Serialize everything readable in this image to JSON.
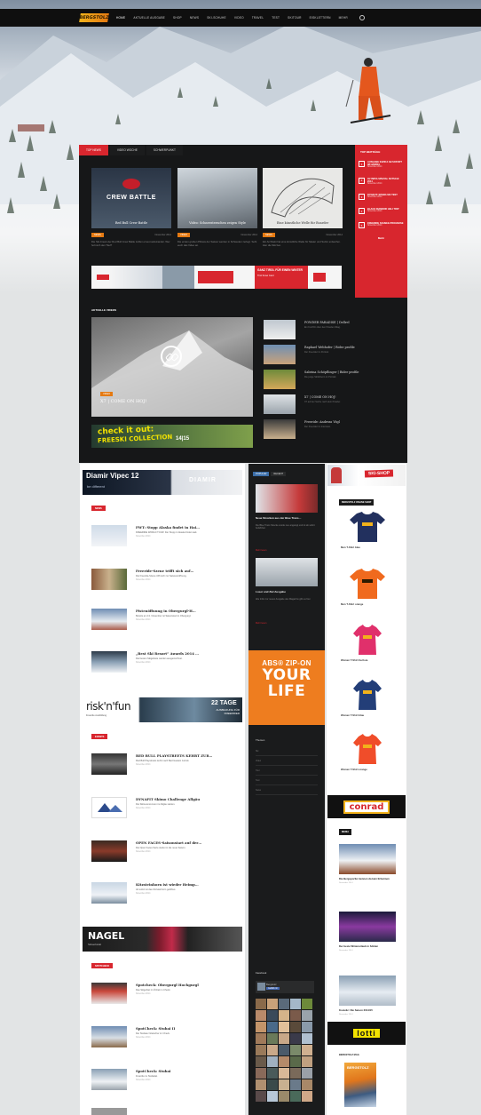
{
  "brand": {
    "logo_text": "BERGSTOLZ",
    "accent": "#d8262e",
    "orange": "#e57a12"
  },
  "nav": {
    "items": [
      "Home",
      "Aktuelle Ausgabe",
      "Shop",
      "News",
      "Ski-Schuhe",
      "Video",
      "Travel",
      "Test",
      "Skitour",
      "Eisklettern",
      "Mehr"
    ],
    "search_icon": "search-icon"
  },
  "feature_tabs": [
    "Top News",
    "Video Woche",
    "Schwerpunkt"
  ],
  "feature_cards": [
    {
      "caption": "Red Bull Crew Battle",
      "badge": "News",
      "date": "November 2014",
      "excerpt": "Die Ski-Crews der Red Bull Crew Battle treffen erneut aufeinander. Wer holt sich den Titel?"
    },
    {
      "caption": "Video: Schneesternchen zeigen Style",
      "badge": "Video",
      "date": "November 2014",
      "excerpt": "Die ersten großen Pillows der Saison werden in Schweden zerlegt. Seht euch das Video an."
    },
    {
      "caption": "Eine künstliche Welle für Boarder",
      "badge": "News",
      "date": "November 2014",
      "excerpt": "Ein Architekt hat eine künstliche Welle für Skater und Surfer entworfen. Hier die Skizzen."
    }
  ],
  "strip_ad": {
    "headline": "GANZ TIROL FÜR EINEN WINTER",
    "sub": "Tirol Snow Card"
  },
  "top_list": {
    "title": "Top Beiträge",
    "items": [
      {
        "num": "1",
        "text": "Ausgabe 04/2014 ab sofort im Handel",
        "date": "November 2014"
      },
      {
        "num": "2",
        "text": "Olympia Spezial Sotschi 2014",
        "date": "November 2014"
      },
      {
        "num": "3",
        "text": "Dynafit: Speed-Ski Test",
        "date": "November 2014"
      },
      {
        "num": "4",
        "text": "Black Diamond Heli Trip",
        "date": "November 2014"
      },
      {
        "num": "5",
        "text": "Freeride Schnee-Prognose",
        "date": "November 2014"
      }
    ],
    "more": "Mehr"
  },
  "video_section": {
    "title": "Aktuelle Videos",
    "main": {
      "badge": "Video",
      "title": "X7 | COME ON HOJ!"
    },
    "list": [
      {
        "title": "POWDER PARADISE | Dellrel",
        "text": "Ein Kurzfilm über den Powder Alltag."
      },
      {
        "title": "Raphael Webhofer | Rider profile",
        "text": "Der Freerider im Portrait."
      },
      {
        "title": "Sabrina Schöpflinger | Rider profile",
        "text": "Die junge Skifahrerin im Portrait."
      },
      {
        "title": "X7 | COME ON HOJ!",
        "text": "X7 auf der Suche nach dem Powder."
      },
      {
        "title": "Freeride: Andreas Vögl",
        "text": "Der Freerider im Interview."
      }
    ]
  },
  "freeski_ad": {
    "line1": "check it out:",
    "line2": "FREESKI COLLECTION",
    "line3": "14|15"
  },
  "diamir_ad": {
    "title": "Diamir Vipec 12",
    "sub": "be different",
    "brand": "DIAMIR"
  },
  "news": {
    "label": "News",
    "posts": [
      {
        "title": "FWT: Stopp Alaska findet in Hai…",
        "text": "FREERIDE WORLD TOUR: Der Stopp in Alaska findet statt.",
        "date": "November 2014"
      },
      {
        "title": "Freeride-Szene trifft sich auf…",
        "text": "Die Freeride-Szene trifft sich zur Saisoneröffnung.",
        "date": "November 2014"
      },
      {
        "title": "Pistenöffnung in Obergurgl-H…",
        "text": "Bereits am 13. November ist Saisonstart in Obergurgl.",
        "date": "November 2014"
      },
      {
        "title": "„Best Ski Resort“ Awards 2014 …",
        "text": "Die besten Skigebiete werden ausgezeichnet.",
        "date": "November 2014"
      }
    ]
  },
  "risk_ad": {
    "brand": "risk'n'fun",
    "sub": "Freeride Ausbildung",
    "days": "22 TAGE",
    "detail": "AUSBILDUNG FÜR FREERIDER"
  },
  "events": {
    "label": "Events",
    "posts": [
      {
        "title": "RED BULL PLAYSTREETS KEHRT ZUR…",
        "text": "Red Bull Playstreets kehrt nach Bad Gastein zurück.",
        "date": "November 2014"
      },
      {
        "title": "DYNAFIT Skimo Challenge Allgäu",
        "text": "Die Skitourenrennen im Allgäu starten.",
        "date": "November 2014"
      },
      {
        "title": "OPEN FACES-Saisonstart auf der…",
        "text": "Die Open Faces Serie startet in die neue Saison.",
        "date": "November 2014"
      },
      {
        "title": "Kitzsteinhorn ist wieder Heimp…",
        "text": "Ab sofort ist das Kitzsteinhorn geöffnet.",
        "date": "November 2014"
      }
    ]
  },
  "nagel_ad": {
    "brand": "NAGEL",
    "sub": "Skiwerkstatt"
  },
  "spotcheck": {
    "label": "Spotcheck",
    "posts": [
      {
        "title": "Spotcheck: Obergurgl Hochgurgl",
        "text": "Das Skigebiet im Ötztal im Check.",
        "date": "November 2014"
      },
      {
        "title": "SpotCheck: Stubai II",
        "text": "Der Stubaier Gletscher im Check.",
        "date": "November 2014"
      },
      {
        "title": "SpotCheck: Stubai",
        "text": "Freeride im Stubaital.",
        "date": "November 2014"
      }
    ]
  },
  "mid": {
    "tabs": [
      "Popular",
      "Recent"
    ],
    "items": [
      {
        "title": "Neue Strecken aus der Blue Trans…",
        "text": "Die Blue Trans Strecke wurde neu angelegt und ist ab sofort befahrbar.",
        "more": "Mehr lesen"
      },
      {
        "title": "Loser und Ziel Ausgabe",
        "text": "Alle Infos zur neuen Ausgabe des Magazins gibt es hier.",
        "more": "Mehr lesen"
      }
    ],
    "abs_ad": {
      "line1": "ABS® ZIP-ON",
      "line2": "YOUR LIFE"
    },
    "tags_title": "Themen",
    "tags": [
      "Ski",
      "Video",
      "Tour",
      "Test",
      "News"
    ],
    "fb_title": "Facebook",
    "fb_page": "Bergstolz",
    "fb_like": "Gefällt mir"
  },
  "right": {
    "shop_banner": "SKI-SHOP",
    "shop_label": "Bergstolz Online Shop",
    "shirts": [
      {
        "name": "Men T-Shirt blau",
        "color": "#22305e"
      },
      {
        "name": "Men T-Shirt orange",
        "color": "#f06a1e"
      },
      {
        "name": "Women T-Shirt fuchsia",
        "color": "#e0306b"
      },
      {
        "name": "Women T-Shirt blau",
        "color": "#233e78"
      },
      {
        "name": "Women T-Shirt orange",
        "color": "#f04d2a"
      }
    ],
    "conrad_ad": "conrad",
    "media_label": "Media",
    "posts": [
      {
        "title": "Die Bergsportler kennen da kein Erbarmen",
        "date": "November 2014"
      },
      {
        "title": "Der beste Winterurlaub in Sölden",
        "date": "November 2014"
      },
      {
        "title": "Kostelic: Die Saison 2014/15",
        "date": "November 2014"
      }
    ],
    "lotti_ad": "lotti",
    "mag_title": "Bergstolz Mag",
    "mag_cover": "BERGSTOLZ"
  }
}
